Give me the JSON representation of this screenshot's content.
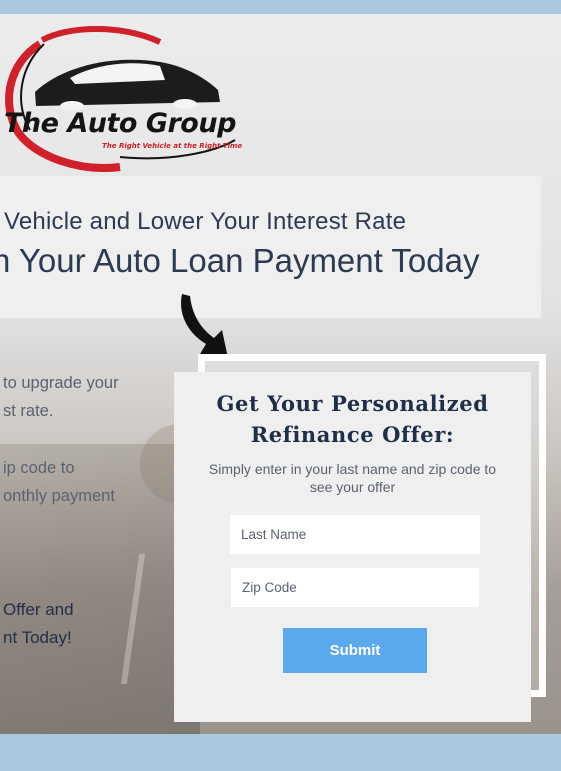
{
  "logo": {
    "name": "The Auto Group",
    "tagline": "The Right Vehicle at the Right Time"
  },
  "headline": {
    "line1": "Vehicle and Lower Your Interest Rate",
    "line2": "n Your Auto Loan Payment Today"
  },
  "left_copy": {
    "block1": [
      "to upgrade your",
      "st rate."
    ],
    "block2": [
      "ip code to",
      "onthly payment"
    ],
    "block3": [
      "Offer and",
      "nt Today!"
    ]
  },
  "form": {
    "title_line1": "Get Your Personalized",
    "title_line2": "Refinance Offer:",
    "subtitle": "Simply enter in your last name and zip code to see your offer",
    "last_name_placeholder": "Last Name",
    "zip_placeholder": "Zip Code",
    "submit_label": "Submit"
  },
  "colors": {
    "accent": "#5aa9ec",
    "navy": "#1f2e49",
    "brand_red": "#d0202a",
    "page_bg": "#a9c8dd"
  },
  "icons": [
    "arrow-down-right-icon",
    "car-logo-icon"
  ]
}
